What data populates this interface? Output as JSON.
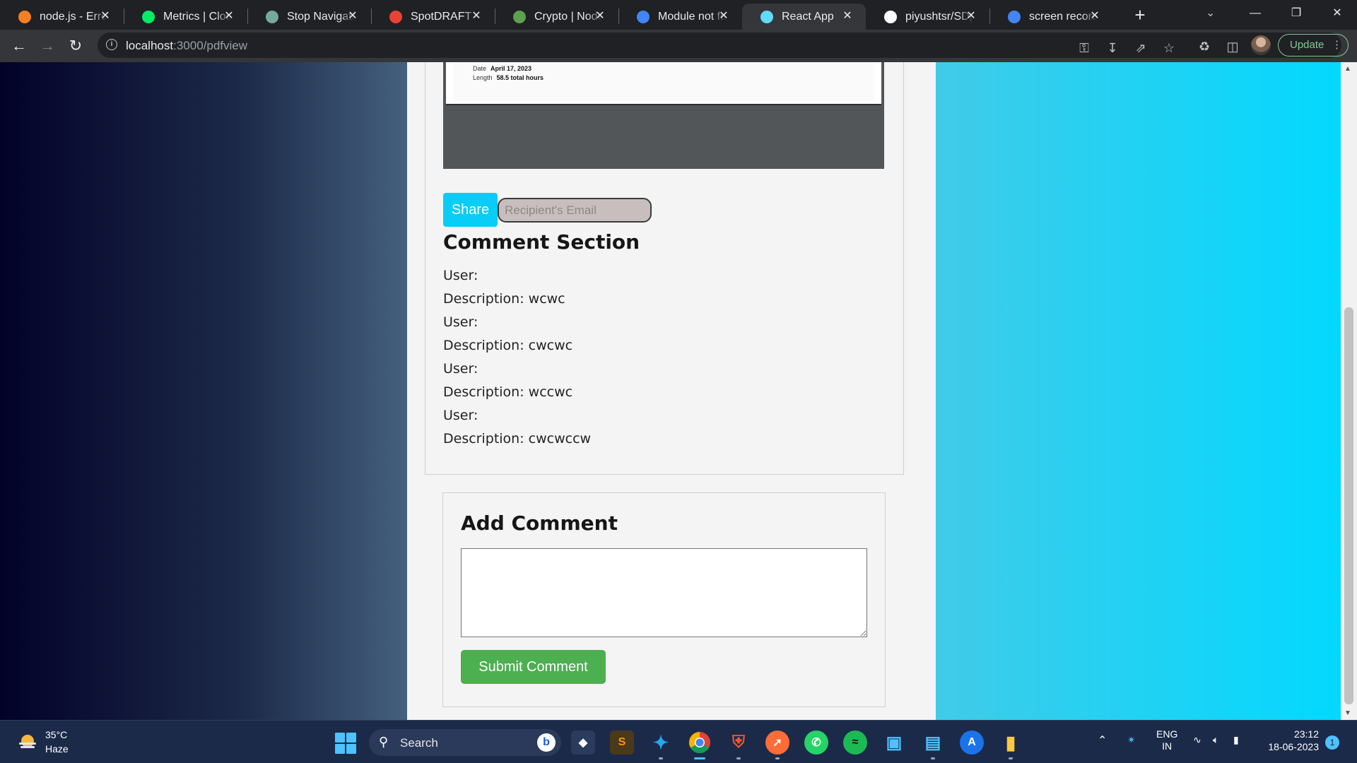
{
  "browser": {
    "tabs": [
      {
        "title": "node.js - Error",
        "favicon": "stackoverflow-icon",
        "color": "#f48024"
      },
      {
        "title": "Metrics | Cloud",
        "favicon": "mongodb-icon",
        "color": "#00ed64"
      },
      {
        "title": "Stop Navigating",
        "favicon": "chatgpt-icon",
        "color": "#74aa9c"
      },
      {
        "title": "SpotDRAFT - A",
        "favicon": "gmail-icon",
        "color": "#ea4335"
      },
      {
        "title": "Crypto | Node",
        "favicon": "nodejs-icon",
        "color": "#5fa04e"
      },
      {
        "title": "Module not fo",
        "favicon": "google-icon",
        "color": "#4285f4"
      },
      {
        "title": "React App",
        "favicon": "react-icon",
        "color": "#61dafb"
      },
      {
        "title": "piyushtsr/SDp",
        "favicon": "github-icon",
        "color": "#ffffff"
      },
      {
        "title": "screen record",
        "favicon": "google-icon",
        "color": "#4285f4"
      }
    ],
    "url_host": "localhost",
    "url_path": ":3000/pdfview",
    "update_label": "Update"
  },
  "pdf": {
    "date_label": "Date",
    "date_value": "April 17, 2023",
    "length_label": "Length",
    "length_value": "58.5 total hours"
  },
  "share": {
    "button_label": "Share",
    "email_placeholder": "Recipient's Email"
  },
  "comments": {
    "heading": "Comment Section",
    "items": [
      {
        "user": "User:",
        "description": "Description: wcwc"
      },
      {
        "user": "User:",
        "description": "Description: cwcwc"
      },
      {
        "user": "User:",
        "description": "Description: wccwc"
      },
      {
        "user": "User:",
        "description": "Description: cwcwccw"
      }
    ]
  },
  "add_comment": {
    "heading": "Add Comment",
    "textarea_value": "",
    "submit_label": "Submit Comment"
  },
  "taskbar": {
    "weather_temp": "35°C",
    "weather_desc": "Haze",
    "search_label": "Search",
    "language_line1": "ENG",
    "language_line2": "IN",
    "time": "23:12",
    "date": "18-06-2023",
    "notification_count": "1"
  },
  "colors": {
    "share_button": "#08cdf7",
    "submit_button": "#4caf50",
    "page_gradient_left": "#020228",
    "page_gradient_right": "#00d9ff"
  }
}
